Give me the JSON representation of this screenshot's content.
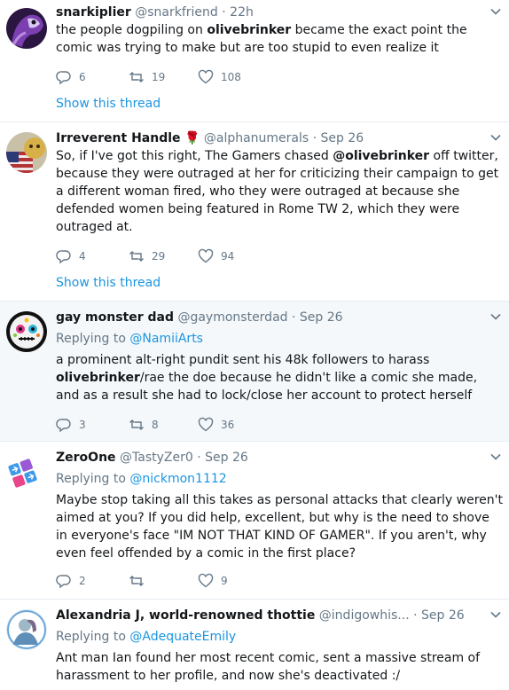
{
  "colors": {
    "link": "#1b95e0",
    "meta": "#657786",
    "text": "#14171a",
    "highlight_bg": "#f5f8fa",
    "divider": "#e6ecf0",
    "rose": "#c0182b"
  },
  "tweets": [
    {
      "name": "snarkiplier",
      "handle": "@snarkfriend",
      "time": "22h",
      "text_before": "the people dogpiling on ",
      "text_bold": "olivebrinker",
      "text_after": " became the exact point the comic was trying to make but are too stupid to even realize it",
      "replies": "6",
      "retweets": "19",
      "likes": "108",
      "show_thread": "Show this thread",
      "avatar_icon": "purple-creature-avatar"
    },
    {
      "name": "Irreverent Handle",
      "name_emoji": "🌹",
      "handle": "@alphanumerals",
      "time": "Sep 26",
      "text_before": "So, if I've got this right, The Gamers chased ",
      "text_bold": "@olivebrinker",
      "text_after": " off twitter, because they were outraged at her for criticizing their campaign to get a different woman fired, who they were outraged at because she defended women being featured in Rome TW 2, which they were outraged at.",
      "replies": "4",
      "retweets": "29",
      "likes": "94",
      "show_thread": "Show this thread",
      "avatar_icon": "flag-avatar"
    },
    {
      "name": "gay monster dad",
      "handle": "@gaymonsterdad",
      "time": "Sep 26",
      "replying_label": "Replying to",
      "replying_to": "@NamiiArts",
      "text_before": "a prominent alt-right pundit sent his 48k followers to harass ",
      "text_bold": "olivebrinker",
      "text_after": "/rae the doe because he didn't like a comic she made, and as a result she had to lock/close her account to protect herself",
      "replies": "3",
      "retweets": "8",
      "likes": "36",
      "avatar_icon": "sugar-skull-avatar"
    },
    {
      "name": "ZeroOne",
      "handle": "@TastyZer0",
      "time": "Sep 26",
      "replying_label": "Replying to",
      "replying_to": "@nickmon1112",
      "text": "Maybe stop taking all this takes as personal attacks that clearly weren't aimed at you? If you did help, excellent, but why is the need to shove in everyone's face \"IM NOT THAT KIND OF GAMER\".  If you aren't, why even feel offended by a comic in the first place?",
      "replies": "2",
      "retweets": "",
      "likes": "9",
      "avatar_icon": "arrow-tiles-avatar"
    },
    {
      "name": "Alexandria J, world-renowned thottie",
      "handle": "@indigowhis...",
      "time": "Sep 26",
      "replying_label": "Replying to",
      "replying_to": "@AdequateEmily",
      "text": "Ant man Ian found her most recent comic, sent a massive stream of harassment to her profile, and now she's deactivated :/",
      "avatar_icon": "portrait-avatar"
    }
  ]
}
